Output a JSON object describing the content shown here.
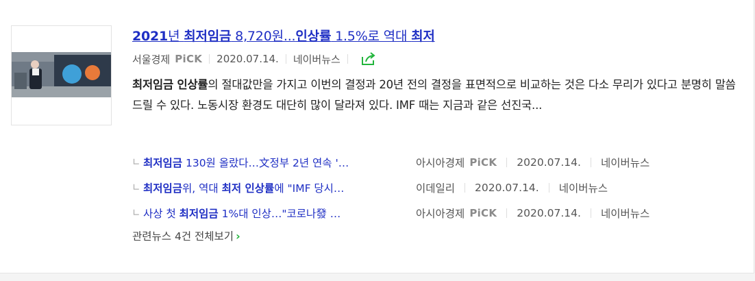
{
  "article": {
    "title_parts": {
      "p1": "2021",
      "p2": "년 ",
      "p3": "최저임금",
      "p4": " 8,720원...",
      "p5": "인상률",
      "p6": " 1.5%로 역대 ",
      "p7": "최저"
    },
    "press": "서울경제",
    "pick": "PiCK",
    "date": "2020.07.14.",
    "naver": "네이버뉴스",
    "share_icon": "share-icon",
    "desc": {
      "b1": "최저임금 인상률",
      "t1": "의 절대값만을 가지고 이번의 결정과 20년 전의 결정을 표면적으로 비교하는 것은 다소 무리가 있다고 분명히 말씀 드릴 수 있다. 노동시장 환경도 대단히 많이 달라져 있다. IMF 때는 지금과 같은 선진국..."
    }
  },
  "related": [
    {
      "b1": "최저임금",
      "t1": " 130원 올랐다…文정부 2년 연속 '…",
      "press": "아시아경제",
      "pick": "PiCK",
      "date": "2020.07.14.",
      "naver": "네이버뉴스"
    },
    {
      "b1": "최저임금",
      "t1": "위, 역대 ",
      "b2": "최저 인상률",
      "t2": "에 \"IMF 당시…",
      "press": "이데일리",
      "date": "2020.07.14.",
      "naver": "네이버뉴스"
    },
    {
      "t1": "사상 첫 ",
      "b1": "최저임금",
      "t2": " 1%대 인상…\"코로나發 …",
      "press": "아시아경제",
      "pick": "PiCK",
      "date": "2020.07.14.",
      "naver": "네이버뉴스"
    }
  ],
  "more": {
    "label": "관련뉴스 4건 전체보기",
    "arrow": "›"
  },
  "colors": {
    "link": "#1f2fc4",
    "accent_green": "#22b53c",
    "meta": "#555555"
  }
}
